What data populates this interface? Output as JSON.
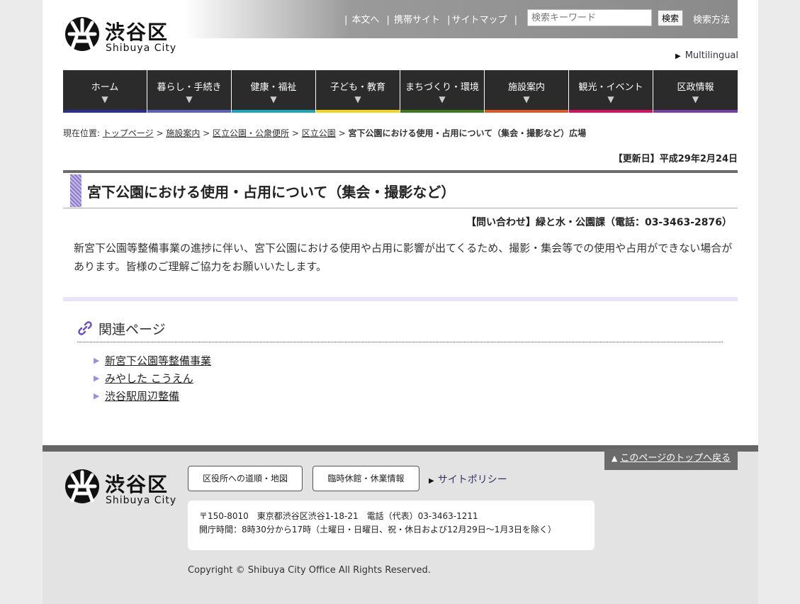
{
  "header": {
    "logo_jp": "渋谷区",
    "logo_en": "Shibuya City",
    "links": [
      "本文へ",
      "携帯サイト",
      "サイトマップ"
    ],
    "search_placeholder": "検索キーワード",
    "search_button": "検索",
    "search_method": "検索方法",
    "multilingual": "Multilingual"
  },
  "nav": [
    {
      "label": "ホーム",
      "color": "#2b2f8f"
    },
    {
      "label": "暮らし・手続き",
      "color": "#5c61b8"
    },
    {
      "label": "健康・福祉",
      "color": "#1aa6b7"
    },
    {
      "label": "子ども・教育",
      "color": "#f2d321"
    },
    {
      "label": "まちづくり・環境",
      "color": "#3a7a1e"
    },
    {
      "label": "施設案内",
      "color": "#e0582a"
    },
    {
      "label": "観光・イベント",
      "color": "#d4125f"
    },
    {
      "label": "区政情報",
      "color": "#7b3e9e"
    }
  ],
  "breadcrumb": {
    "prefix": "現在位置:",
    "items": [
      "トップページ",
      "施設案内",
      "区立公園・公衆便所",
      "区立公園"
    ],
    "current": "宮下公園における使用・占用について（集会・撮影など）広場"
  },
  "updated": "【更新日】平成29年2月24日",
  "title": "宮下公園における使用・占用について（集会・撮影など）",
  "contact": "【問い合わせ】緑と水・公園課（電話：03-3463-2876）",
  "body": "新宮下公園等整備事業の進捗に伴い、宮下公園における使用や占用に影響が出てくるため、撮影・集会等での使用や占用ができない場合があります。皆様のご理解ご協力をお願いいたします。",
  "related": {
    "title": "関連ページ",
    "links": [
      "新宮下公園等整備事業",
      "みやした こうえん",
      "渋谷駅周辺整備"
    ]
  },
  "footer": {
    "back_top": "このページのトップへ戻る",
    "btn_map": "区役所への道順・地図",
    "btn_closed": "臨時休館・休業情報",
    "policy": "サイトポリシー",
    "address": "〒150-8010　東京都渋谷区渋谷1-18-21　電話（代表）03-3463-1211",
    "hours": "開庁時間：8時30分から17時（土曜日・日曜日、祝・休日および12月29日～1月3日を除く）",
    "copyright": "Copyright © Shibuya City Office All Rights Reserved."
  }
}
